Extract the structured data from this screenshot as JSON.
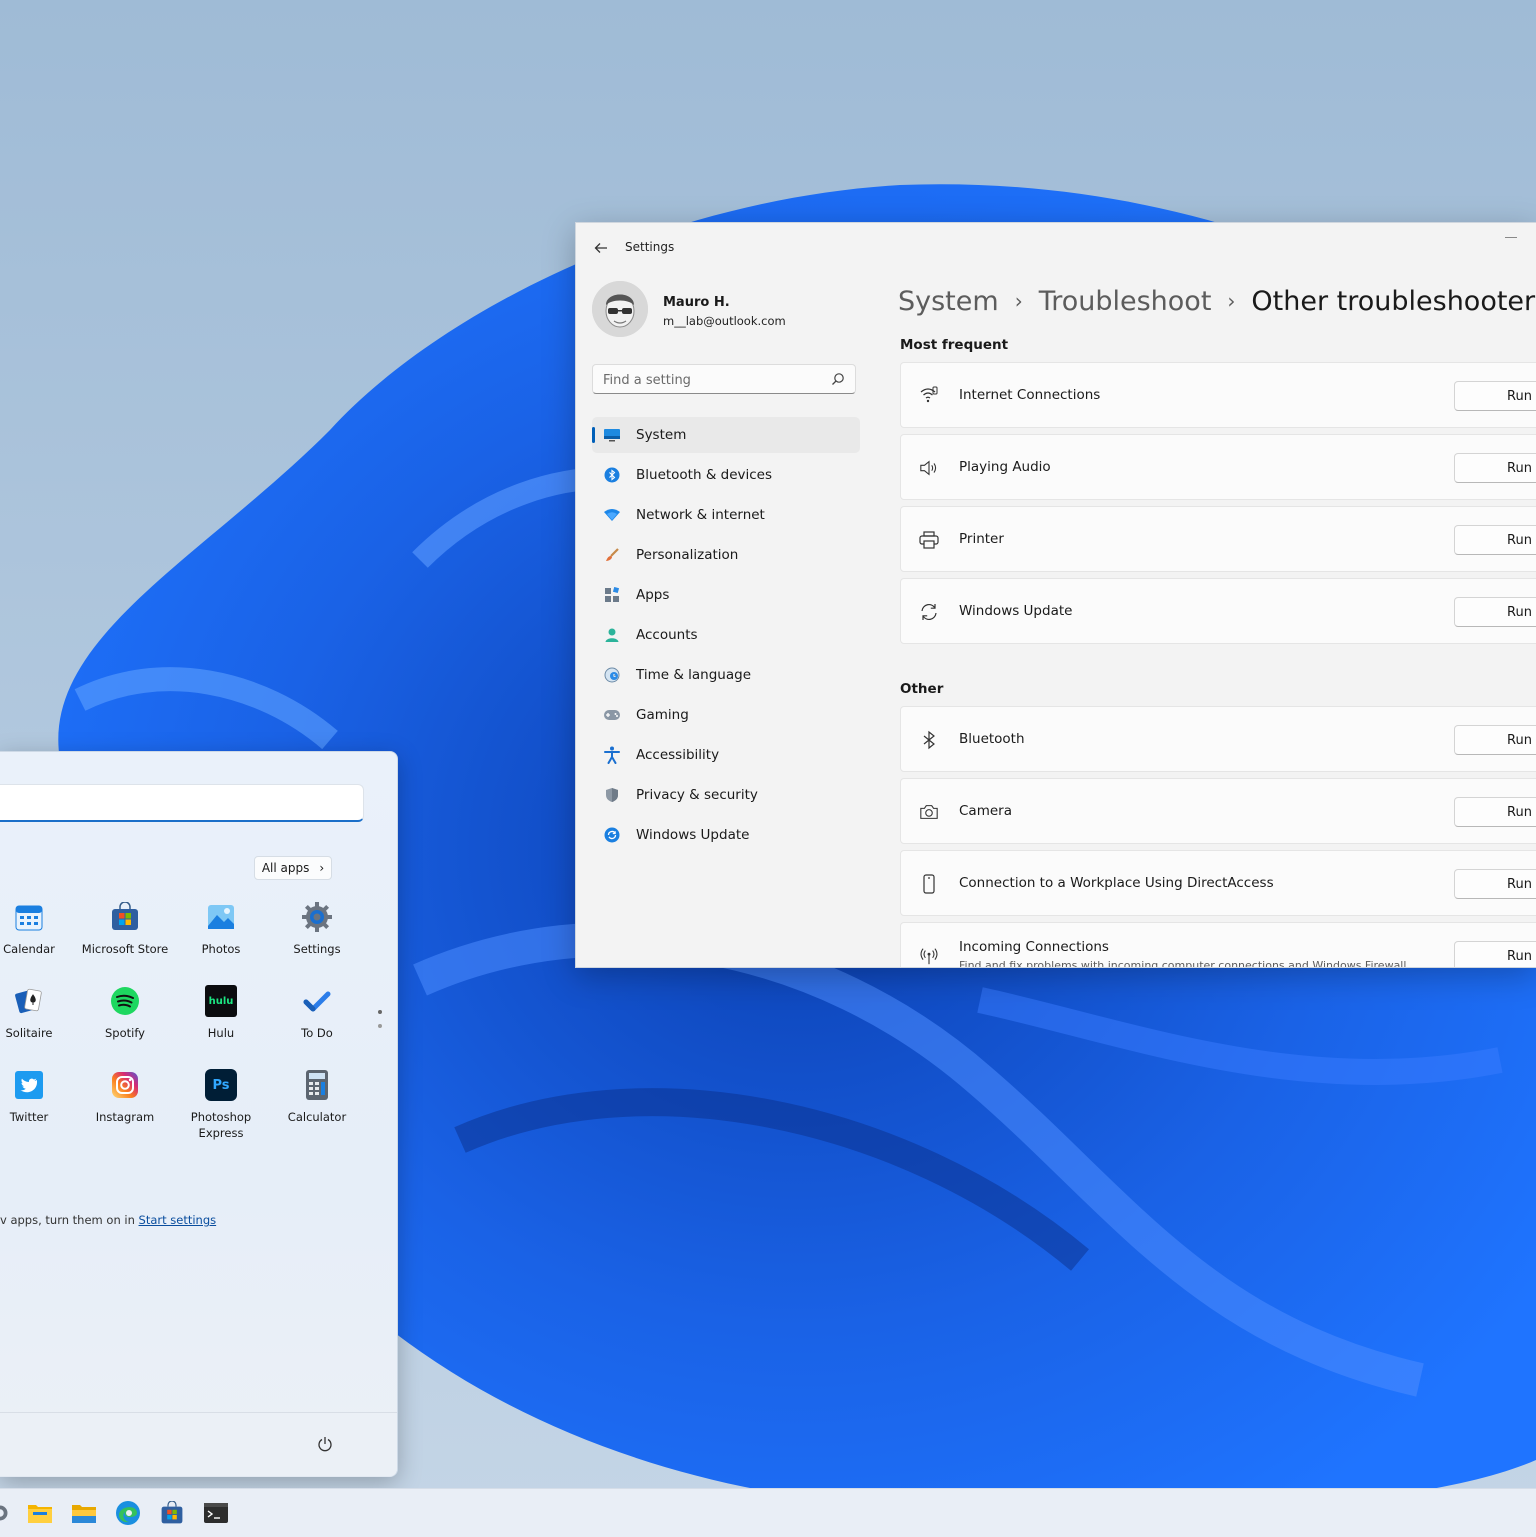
{
  "colors": {
    "accent": "#005fb8",
    "wallpaper_light": "#b9cfe2",
    "wallpaper_blue": "#1757d9",
    "window_bg": "#f3f3f3"
  },
  "settings": {
    "title": "Settings",
    "user": {
      "name": "Mauro H.",
      "email": "m__lab@outlook.com"
    },
    "search": {
      "placeholder": "Find a setting"
    },
    "nav": [
      {
        "label": "System",
        "icon": "system-icon",
        "active": true
      },
      {
        "label": "Bluetooth & devices",
        "icon": "bluetooth-icon"
      },
      {
        "label": "Network & internet",
        "icon": "wifi-icon"
      },
      {
        "label": "Personalization",
        "icon": "brush-icon"
      },
      {
        "label": "Apps",
        "icon": "apps-icon"
      },
      {
        "label": "Accounts",
        "icon": "person-icon"
      },
      {
        "label": "Time & language",
        "icon": "clock-globe-icon"
      },
      {
        "label": "Gaming",
        "icon": "gamepad-icon"
      },
      {
        "label": "Accessibility",
        "icon": "accessibility-icon"
      },
      {
        "label": "Privacy & security",
        "icon": "shield-icon"
      },
      {
        "label": "Windows Update",
        "icon": "update-icon"
      }
    ],
    "breadcrumb": [
      "System",
      "Troubleshoot",
      "Other troubleshooters"
    ],
    "sections": {
      "most_frequent": {
        "title": "Most frequent",
        "items": [
          {
            "label": "Internet Connections",
            "icon": "signal-icon",
            "button": "Run"
          },
          {
            "label": "Playing Audio",
            "icon": "speaker-icon",
            "button": "Run"
          },
          {
            "label": "Printer",
            "icon": "printer-icon",
            "button": "Run"
          },
          {
            "label": "Windows Update",
            "icon": "refresh-icon",
            "button": "Run"
          }
        ]
      },
      "other": {
        "title": "Other",
        "items": [
          {
            "label": "Bluetooth",
            "icon": "bluetooth-icon",
            "button": "Run"
          },
          {
            "label": "Camera",
            "icon": "camera-icon",
            "button": "Run"
          },
          {
            "label": "Connection to a Workplace Using DirectAccess",
            "icon": "phone-icon",
            "button": "Run"
          },
          {
            "label": "Incoming Connections",
            "description": "Find and fix problems with incoming computer connections and Windows Firewall",
            "icon": "antenna-icon",
            "button": "Run"
          }
        ]
      }
    }
  },
  "start_menu": {
    "all_apps_label": "All apps",
    "apps": [
      {
        "label": "Calendar",
        "icon": "calendar-icon"
      },
      {
        "label": "Microsoft Store",
        "icon": "store-icon"
      },
      {
        "label": "Photos",
        "icon": "photos-icon"
      },
      {
        "label": "Settings",
        "icon": "gear-icon"
      },
      {
        "label": "Solitaire",
        "icon": "cards-icon"
      },
      {
        "label": "Spotify",
        "icon": "spotify-icon"
      },
      {
        "label": "Hulu",
        "icon": "hulu-icon",
        "icon_text": "hulu"
      },
      {
        "label": "To Do",
        "icon": "checkmark-icon"
      },
      {
        "label": "Twitter",
        "icon": "twitter-icon"
      },
      {
        "label": "Instagram",
        "icon": "instagram-icon"
      },
      {
        "label": "Photoshop Express",
        "icon": "photoshop-icon",
        "icon_text": "Ps"
      },
      {
        "label": "Calculator",
        "icon": "calculator-icon"
      }
    ],
    "recommended_text": "v apps, turn them on in ",
    "recommended_link": "Start settings"
  },
  "taskbar": {
    "icons": [
      "gear-icon",
      "folder-icon",
      "file-explorer-icon",
      "edge-icon",
      "store-icon",
      "terminal-icon"
    ]
  }
}
